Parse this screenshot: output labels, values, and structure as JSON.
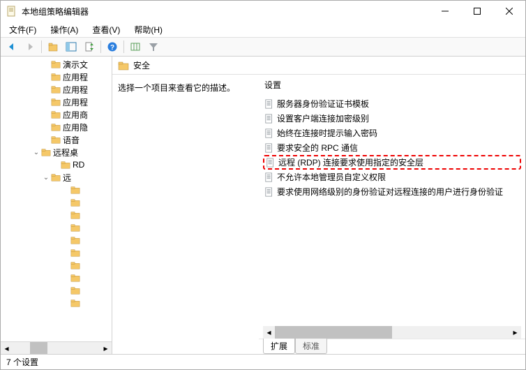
{
  "window": {
    "title": "本地组策略编辑器"
  },
  "menu": {
    "file": "文件(F)",
    "action": "操作(A)",
    "view": "查看(V)",
    "help": "帮助(H)"
  },
  "tree": {
    "items": [
      {
        "indent": 58,
        "label": "演示文",
        "chev": ""
      },
      {
        "indent": 58,
        "label": "应用程",
        "chev": ""
      },
      {
        "indent": 58,
        "label": "应用程",
        "chev": ""
      },
      {
        "indent": 58,
        "label": "应用程",
        "chev": ""
      },
      {
        "indent": 58,
        "label": "应用商",
        "chev": ""
      },
      {
        "indent": 58,
        "label": "应用隐",
        "chev": ""
      },
      {
        "indent": 58,
        "label": "语音",
        "chev": ""
      },
      {
        "indent": 44,
        "label": "远程桌",
        "chev": "v"
      },
      {
        "indent": 72,
        "label": "RD",
        "chev": ""
      },
      {
        "indent": 58,
        "label": "远",
        "chev": "v"
      },
      {
        "indent": 86,
        "label": "",
        "chev": ""
      },
      {
        "indent": 86,
        "label": "",
        "chev": ""
      },
      {
        "indent": 86,
        "label": "",
        "chev": ""
      },
      {
        "indent": 86,
        "label": "",
        "chev": ""
      },
      {
        "indent": 86,
        "label": "",
        "chev": ""
      },
      {
        "indent": 86,
        "label": "",
        "chev": ""
      },
      {
        "indent": 86,
        "label": "",
        "chev": ""
      },
      {
        "indent": 86,
        "label": "",
        "chev": ""
      },
      {
        "indent": 86,
        "label": "",
        "chev": ""
      },
      {
        "indent": 86,
        "label": "",
        "chev": ""
      }
    ]
  },
  "header": {
    "title": "安全"
  },
  "desc": {
    "text": "选择一个项目来查看它的描述。"
  },
  "settings": {
    "column": "设置",
    "items": [
      {
        "label": "服务器身份验证证书模板",
        "hl": false
      },
      {
        "label": "设置客户端连接加密级别",
        "hl": false
      },
      {
        "label": "始终在连接时提示输入密码",
        "hl": false
      },
      {
        "label": "要求安全的 RPC 通信",
        "hl": false
      },
      {
        "label": "远程 (RDP) 连接要求使用指定的安全层",
        "hl": true
      },
      {
        "label": "不允许本地管理员自定义权限",
        "hl": false
      },
      {
        "label": "要求使用网络级别的身份验证对远程连接的用户进行身份验证",
        "hl": false
      }
    ]
  },
  "tabs": {
    "extended": "扩展",
    "standard": "标准"
  },
  "status": {
    "text": "7 个设置"
  }
}
